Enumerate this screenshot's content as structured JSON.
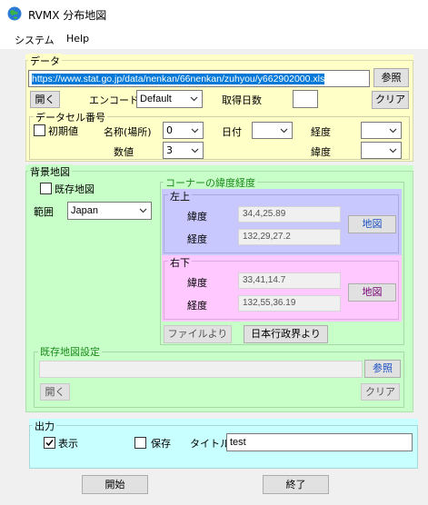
{
  "window": {
    "title": "RVMX 分布地図"
  },
  "menu": {
    "system": "システム",
    "help": "Help"
  },
  "data_group": {
    "title": "データ",
    "url": "https://www.stat.go.jp/data/nenkan/66nenkan/zuhyou/y662902000.xls",
    "browse": "参照",
    "open": "開く",
    "encode_label": "エンコード",
    "encode_value": "Default",
    "fetch_days_label": "取得日数",
    "fetch_days_value": "",
    "clear": "クリア",
    "cell_group": {
      "title": "データセル番号",
      "initial_label": "初期値",
      "name_label": "名称(場所)",
      "name_value": "0",
      "date_label": "日付",
      "date_value": "",
      "longitude_label": "経度",
      "longitude_value": "",
      "value_label": "数値",
      "value_value": "3",
      "latitude_label": "緯度",
      "latitude_value": ""
    }
  },
  "bg_group": {
    "title": "背景地図",
    "existing_map_label": "既存地図",
    "range_label": "範囲",
    "range_value": "Japan",
    "corner_title": "コーナーの緯度経度",
    "top_left": {
      "title": "左上",
      "lat_label": "緯度",
      "lat_value": "34,4,25.89",
      "lon_label": "経度",
      "lon_value": "132,29,27.2",
      "map_btn": "地図"
    },
    "bottom_right": {
      "title": "右下",
      "lat_label": "緯度",
      "lat_value": "33,41,14.7",
      "lon_label": "経度",
      "lon_value": "132,55,36.19",
      "map_btn": "地図"
    },
    "from_file": "ファイルより",
    "admin_boundary": "日本行政界より",
    "existing_settings_title": "既存地図設定",
    "existing_path": "",
    "browse": "参照",
    "open": "開く",
    "clear": "クリア"
  },
  "output_group": {
    "title": "出力",
    "display_label": "表示",
    "display_checked": true,
    "save_label": "保存",
    "save_checked": false,
    "title_label": "タイトル",
    "title_value": "test"
  },
  "footer": {
    "start": "開始",
    "end": "終了"
  },
  "colors": {
    "data_bg": "#ffffc8",
    "bg_green": "#c8ffc8",
    "corner_tl": "#c8c8ff",
    "corner_br": "#ffc8ff",
    "output_bg": "#c8ffff"
  }
}
